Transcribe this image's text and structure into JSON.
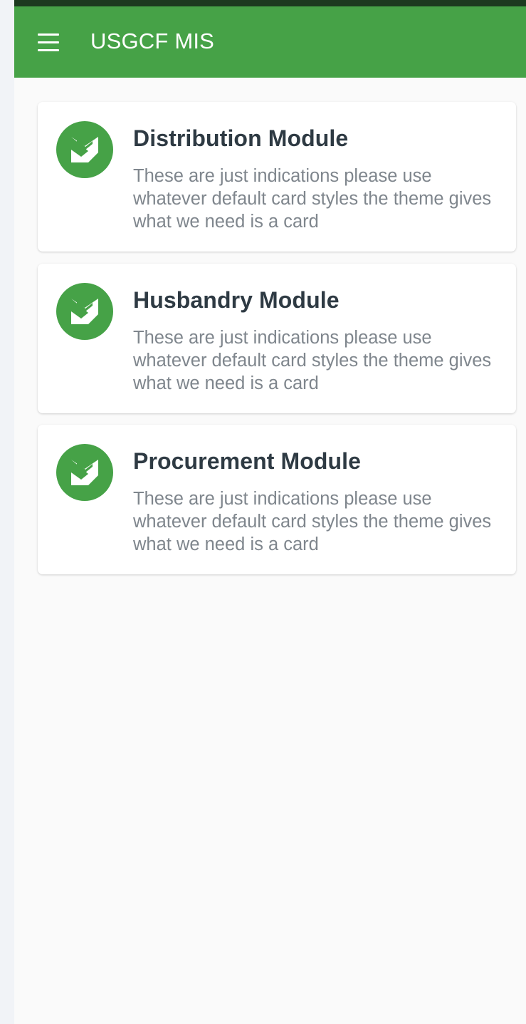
{
  "appbar": {
    "title": "USGCF MIS",
    "menu_icon": "hamburger-menu-icon",
    "color": "#46a247"
  },
  "modules": [
    {
      "title": "Distribution Module",
      "description": "These are just indications please use whatever default card styles the theme gives what we need is a card",
      "icon": "module-logo-icon"
    },
    {
      "title": "Husbandry Module",
      "description": "These are just indications please use whatever default card styles the theme gives what we need is a card",
      "icon": "module-logo-icon"
    },
    {
      "title": "Procurement Module",
      "description": "These are just indications please use whatever default card styles the theme gives what we need is a card",
      "icon": "module-logo-icon"
    }
  ]
}
